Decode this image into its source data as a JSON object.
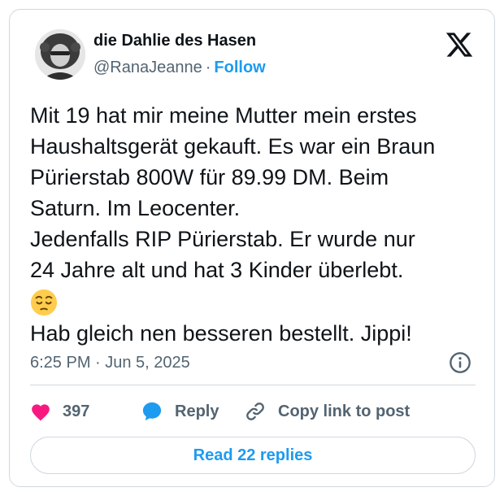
{
  "author": {
    "display_name": "die Dahlie des Hasen",
    "handle": "@RanaJeanne",
    "separator": "·",
    "follow_label": "Follow"
  },
  "icons": {
    "logo": "x-logo-icon",
    "emoji": "pensive-face-emoji",
    "info": "info-icon",
    "like": "heart-icon",
    "reply": "speech-bubble-icon",
    "copy_link": "link-icon"
  },
  "tweet": {
    "lines": [
      "Mit 19 hat mir meine Mutter mein erstes",
      "Haushaltsgerät gekauft. Es war ein Braun",
      "Pürierstab 800W für 89.99 DM. Beim",
      "Saturn. Im Leocenter.",
      "Jedenfalls RIP Pürierstab. Er wurde nur",
      "24 Jahre alt und hat 3 Kinder überlebt.",
      "Hab gleich nen besseren bestellt. Jippi!"
    ],
    "timestamp": "6:25 PM · Jun 5, 2025"
  },
  "actions": {
    "like_count": "397",
    "reply_label": "Reply",
    "copy_link_label": "Copy link to post"
  },
  "read_replies_label": "Read 22 replies",
  "colors": {
    "accent": "#1d9bf0",
    "like": "#f91880",
    "text": "#0f1419",
    "muted": "#536471",
    "border": "#cfd9de",
    "emoji": "#ffcc4d"
  }
}
